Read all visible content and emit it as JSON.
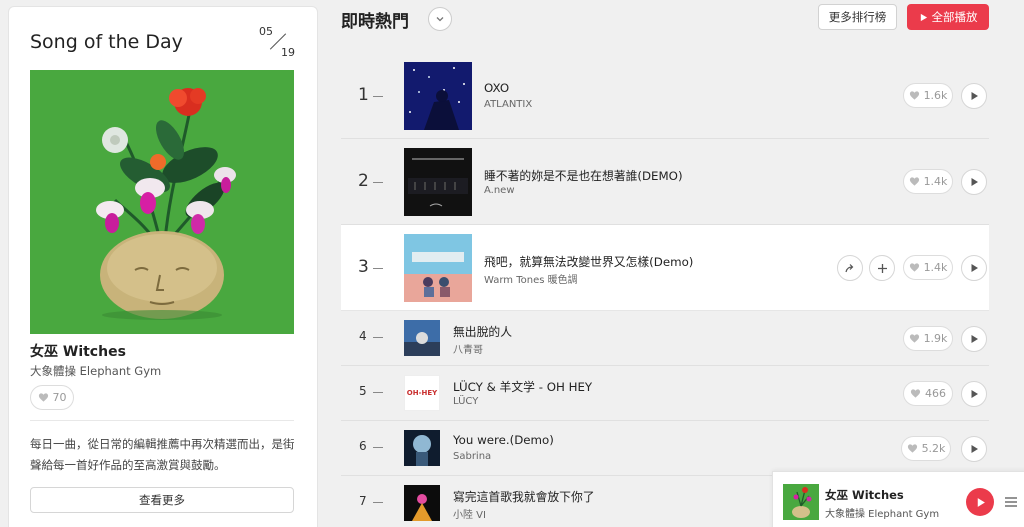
{
  "song_of_day": {
    "title": "Song of the Day",
    "month": "05",
    "day": "19",
    "song": "女巫 Witches",
    "artist": "大象體操 Elephant Gym",
    "likes": "70",
    "description": "每日一曲，從日常的編輯推薦中再次精選而出，是街聲給每一首好作品的至高激賞與鼓勵。",
    "more_label": "查看更多"
  },
  "header": {
    "title": "即時熱門",
    "chart_button": "更多排行榜",
    "play_all_button": "全部播放"
  },
  "tracks": [
    {
      "rank": "1",
      "title": "OXO",
      "artist": "ATLANTIX",
      "likes": "1.6k"
    },
    {
      "rank": "2",
      "title": "睡不著的妳是不是也在想著誰(DEMO)",
      "artist": "A.new",
      "likes": "1.4k"
    },
    {
      "rank": "3",
      "title": "飛吧，就算無法改變世界又怎樣(Demo)",
      "artist": "Warm Tones 暖色調",
      "likes": "1.4k"
    },
    {
      "rank": "4",
      "title": "無出脫的人",
      "artist": "八青哥",
      "likes": "1.9k"
    },
    {
      "rank": "5",
      "title": "LÜCY & 羊文学 - OH HEY",
      "artist": "LÜCY",
      "likes": "466",
      "cover_text": "OH-HEY"
    },
    {
      "rank": "6",
      "title": "You were.(Demo)",
      "artist": "Sabrina",
      "likes": "5.2k"
    },
    {
      "rank": "7",
      "title": "寫完這首歌我就會放下你了",
      "artist": "小陸 VI"
    }
  ],
  "player": {
    "title": "女巫 Witches",
    "artist": "大象體操 Elephant Gym"
  },
  "icons": {
    "heart": "heart-icon",
    "play": "play-icon",
    "share": "share-icon",
    "add": "plus-icon",
    "chevron": "chevron-down-icon",
    "menu": "menu-icon"
  },
  "colors": {
    "accent": "#eb3b4b",
    "artwork_green": "#49a83f"
  }
}
